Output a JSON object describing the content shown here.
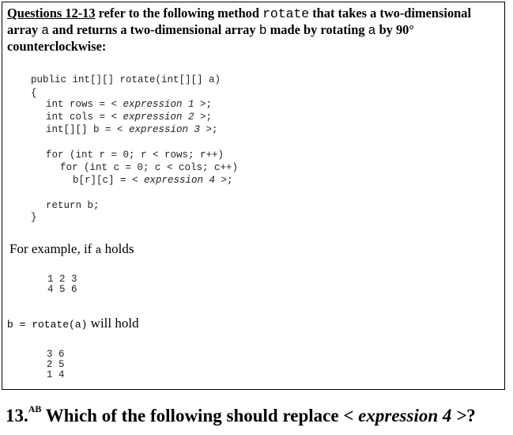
{
  "intro": {
    "qref": "Questions 12-13",
    "p1": " refer to the following method ",
    "method": "rotate",
    "p2": " that takes a two-dimensional array ",
    "arr_a": "a",
    "p3": " and returns a two-dimensional array ",
    "arr_b": "b",
    "p4": " made by rotating ",
    "arr_a2": "a",
    "p5": " by 90° counterclockwise:"
  },
  "code": {
    "signature": "public int[][] rotate(int[][] a)",
    "open_brace": "{",
    "rows_lhs": "int rows = ",
    "rows_expr": "< expression 1 >",
    "rows_end": ";",
    "cols_lhs": "int cols = ",
    "cols_expr": "< expression 2 >",
    "cols_end": ";",
    "b_lhs": "int[][] b = ",
    "b_expr": "< expression 3 >",
    "b_end": ";",
    "for_r": "for (int r = 0; r < rows; r++)",
    "for_c": "for (int c = 0; c < cols; c++)",
    "assign_lhs": "b[r][c] = ",
    "assign_expr": "< expression 4 >",
    "assign_end": ";",
    "return_stmt": "return b;",
    "close_brace": "}"
  },
  "example": {
    "p1": "For example, if ",
    "var": "a",
    "p2": " holds",
    "matrix_a": [
      "1 2 3",
      "4 5 6"
    ],
    "result_code": "b = rotate(a)",
    "result_text": " will hold",
    "matrix_b": [
      "3 6",
      "2 5",
      "1 4"
    ]
  },
  "question": {
    "number": "13.",
    "sup": "AB",
    "text": " Which of the following should replace ",
    "expr": "< expression 4 >",
    "end": "?"
  }
}
